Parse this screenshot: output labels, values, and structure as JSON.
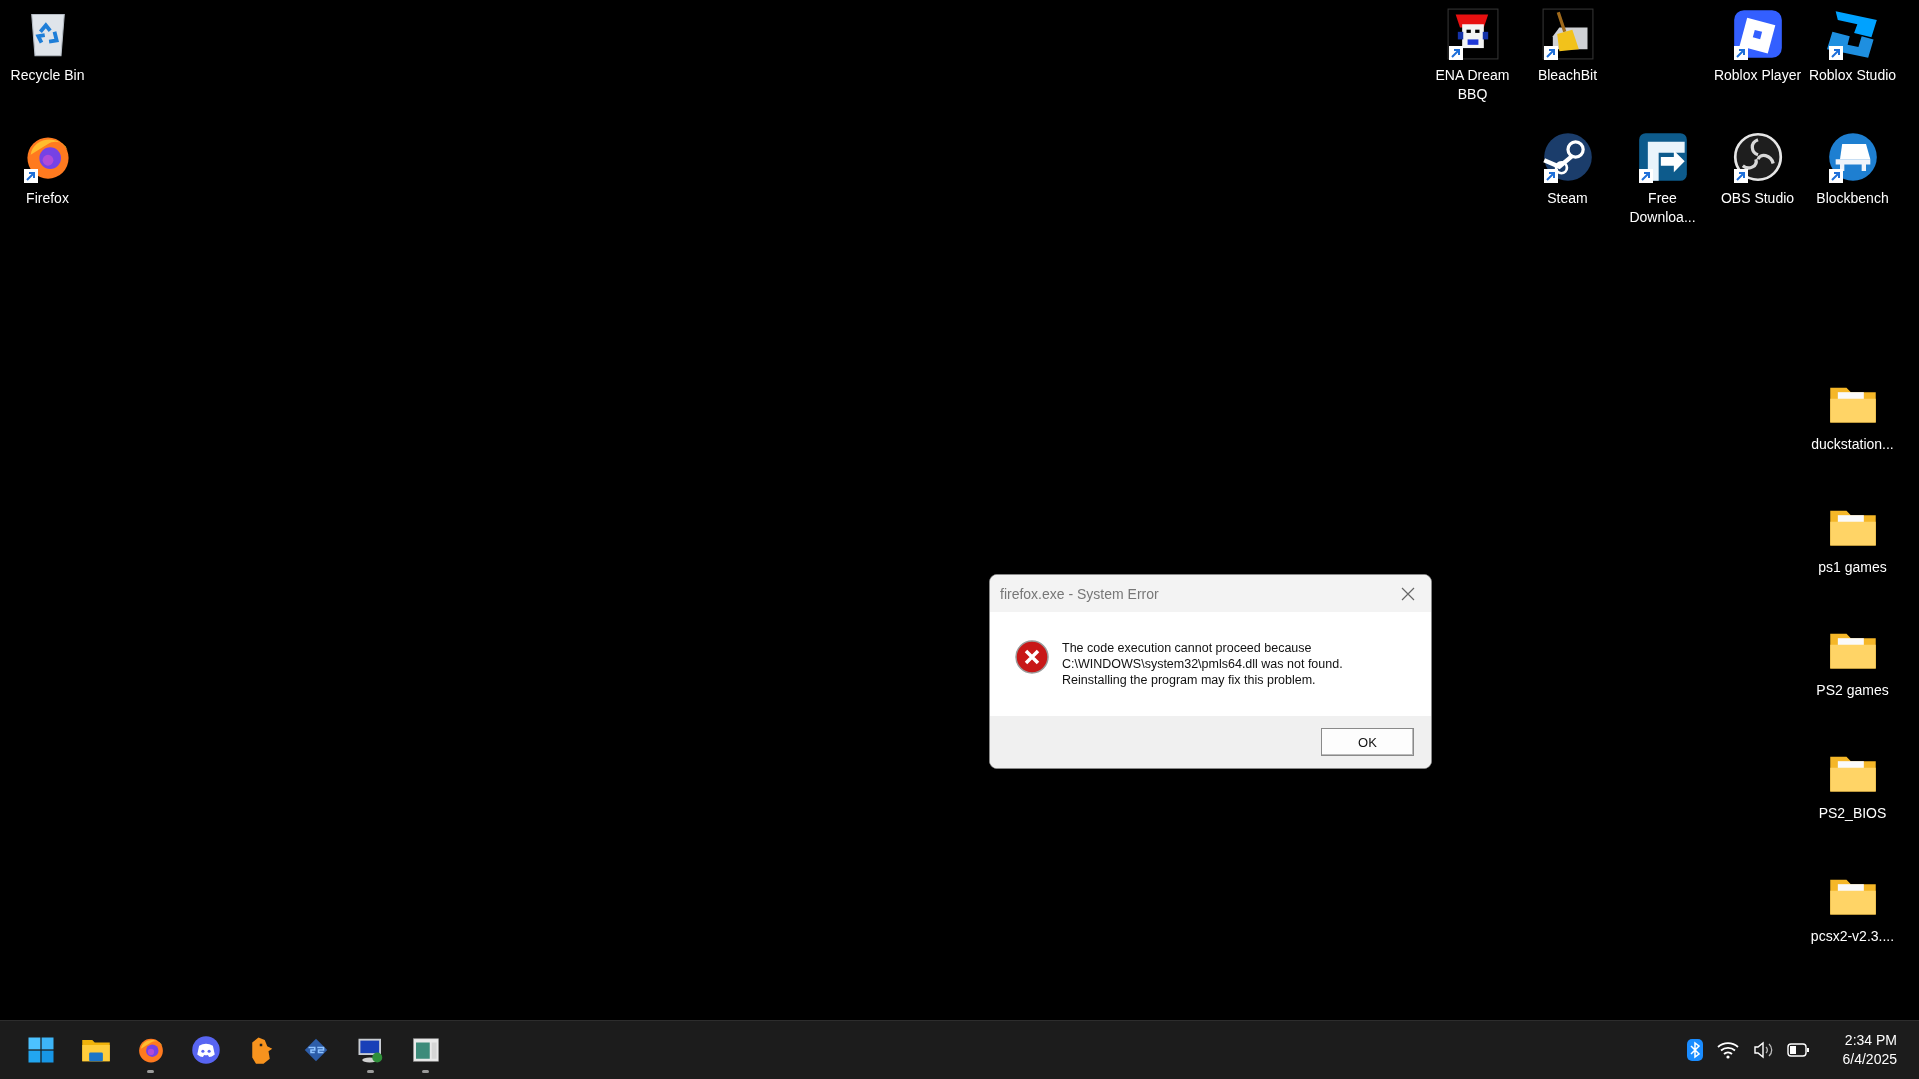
{
  "desktop": {
    "icons": [
      {
        "label": "Recycle Bin",
        "kind": "recycle-bin",
        "shortcut": false
      },
      {
        "label": "ENA Dream BBQ",
        "kind": "ena",
        "shortcut": true
      },
      {
        "label": "BleachBit",
        "kind": "bleachbit",
        "shortcut": true
      },
      {
        "label": "Roblox Player",
        "kind": "roblox-player",
        "shortcut": true
      },
      {
        "label": "Roblox Studio",
        "kind": "roblox-studio",
        "shortcut": true
      },
      {
        "label": "Firefox",
        "kind": "firefox",
        "shortcut": true
      },
      {
        "label": "Steam",
        "kind": "steam",
        "shortcut": true
      },
      {
        "label": "Free Downloa...",
        "kind": "fdm",
        "shortcut": true
      },
      {
        "label": "OBS Studio",
        "kind": "obs",
        "shortcut": true
      },
      {
        "label": "Blockbench",
        "kind": "blockbench",
        "shortcut": true
      },
      {
        "label": "duckstation...",
        "kind": "folder",
        "shortcut": false
      },
      {
        "label": "ps1 games",
        "kind": "folder",
        "shortcut": false
      },
      {
        "label": "PS2 games",
        "kind": "folder",
        "shortcut": false
      },
      {
        "label": "PS2_BIOS",
        "kind": "folder",
        "shortcut": false
      },
      {
        "label": "pcsx2-v2.3....",
        "kind": "folder",
        "shortcut": false
      }
    ]
  },
  "dialog": {
    "title": "firefox.exe - System Error",
    "message": "The code execution cannot proceed because\nC:\\WINDOWS\\system32\\pmls64.dll was not found.\nReinstalling the program may fix this problem.",
    "buttons": [
      "OK"
    ]
  },
  "taskbar": {
    "apps": [
      {
        "kind": "start",
        "running": false
      },
      {
        "kind": "explorer",
        "running": false
      },
      {
        "kind": "firefox",
        "running": true
      },
      {
        "kind": "discord",
        "running": false
      },
      {
        "kind": "duck",
        "running": false
      },
      {
        "kind": "pcsx2",
        "running": false
      },
      {
        "kind": "remote",
        "running": true
      },
      {
        "kind": "window",
        "running": true
      }
    ],
    "time": "2:34 PM",
    "date": "6/4/2025"
  }
}
